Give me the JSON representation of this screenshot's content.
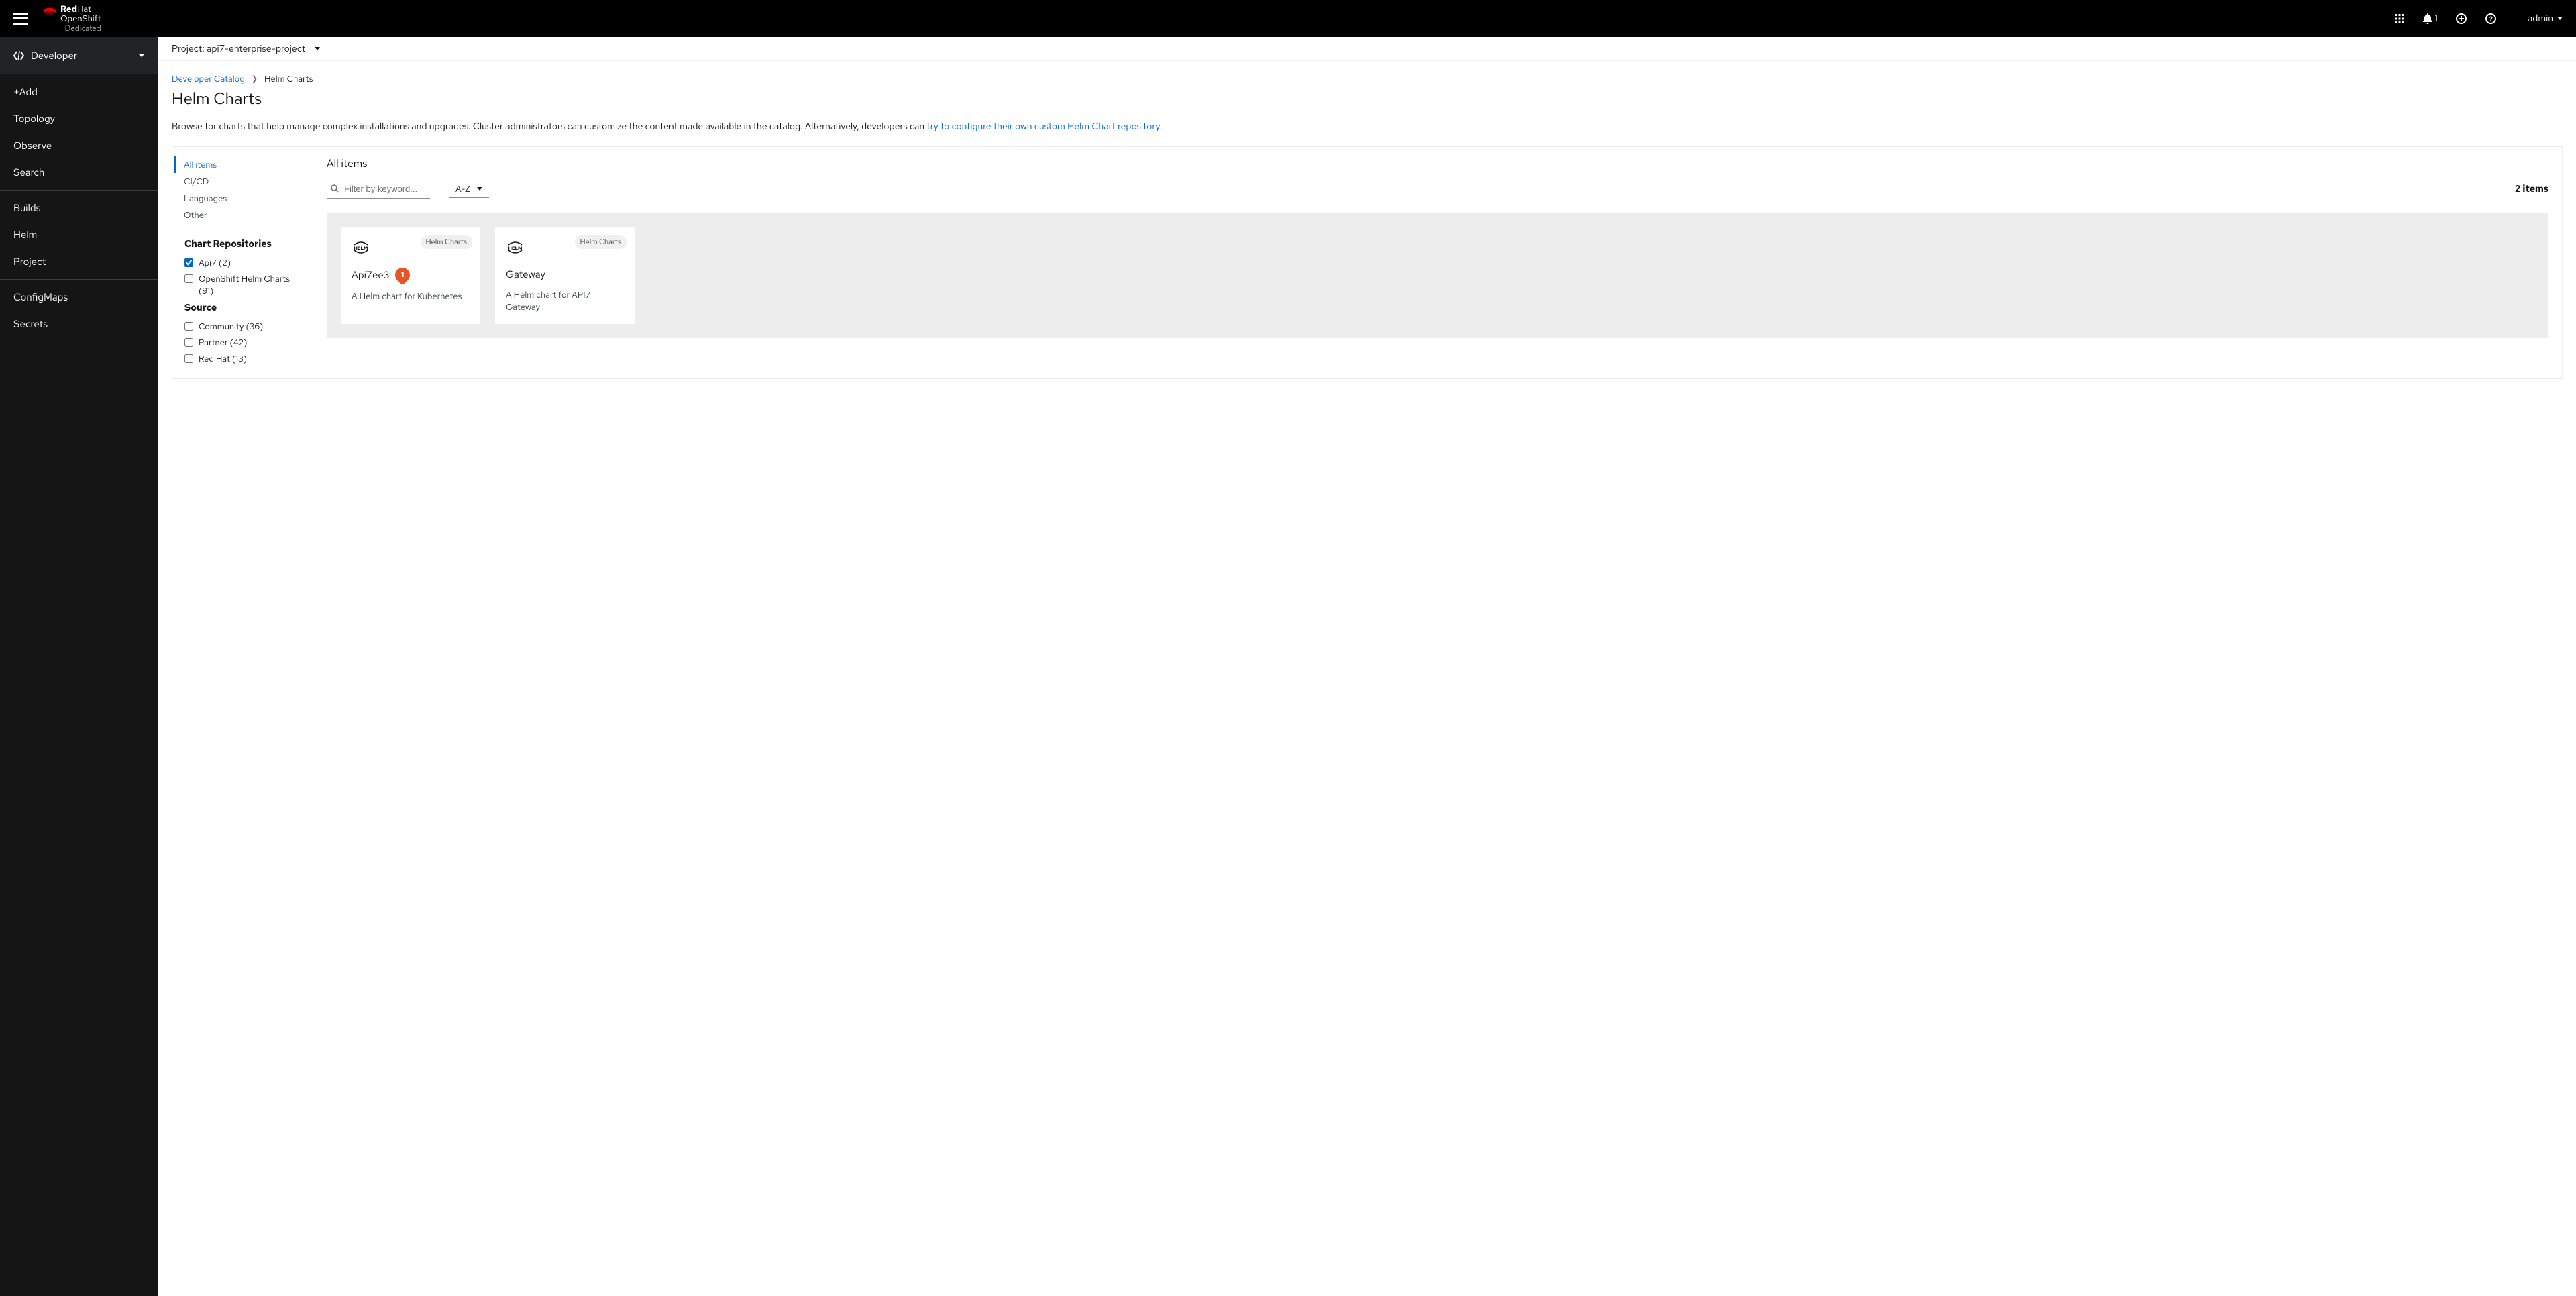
{
  "brand": {
    "line1a": "Red",
    "line1b": "Hat",
    "line2": "OpenShift",
    "line3": "Dedicated"
  },
  "topbar": {
    "notif_count": "1",
    "user": "admin"
  },
  "perspective": {
    "label": "Developer"
  },
  "nav": {
    "g1": [
      "+Add",
      "Topology",
      "Observe",
      "Search"
    ],
    "g2": [
      "Builds",
      "Helm",
      "Project"
    ],
    "g3": [
      "ConfigMaps",
      "Secrets"
    ]
  },
  "project": {
    "prefix": "Project:",
    "name": "api7-enterprise-project"
  },
  "breadcrumb": {
    "root": "Developer Catalog",
    "current": "Helm Charts"
  },
  "page": {
    "title": "Helm Charts",
    "desc1": "Browse for charts that help manage complex installations and upgrades. Cluster administrators can customize the content made available in the catalog. Alternatively, developers can ",
    "desc_link": "try to configure their own custom Helm Chart repository",
    "desc2": "."
  },
  "filters": {
    "types": [
      "All items",
      "CI/CD",
      "Languages",
      "Other"
    ],
    "repos_title": "Chart Repositories",
    "repos": [
      {
        "label": "Api7 (2)",
        "checked": true
      },
      {
        "label": "OpenShift Helm Charts (91)",
        "checked": false
      }
    ],
    "source_title": "Source",
    "sources": [
      {
        "label": "Community (36)",
        "checked": false
      },
      {
        "label": "Partner (42)",
        "checked": false
      },
      {
        "label": "Red Hat (13)",
        "checked": false
      }
    ]
  },
  "results": {
    "heading": "All items",
    "search_placeholder": "Filter by keyword...",
    "sort": "A-Z",
    "count": "2 items",
    "card_badge": "Helm Charts",
    "cards": [
      {
        "title": "Api7ee3",
        "desc": "A Helm chart for Kubernetes",
        "callout": "1"
      },
      {
        "title": "Gateway",
        "desc": "A Helm chart for API7 Gateway"
      }
    ]
  }
}
